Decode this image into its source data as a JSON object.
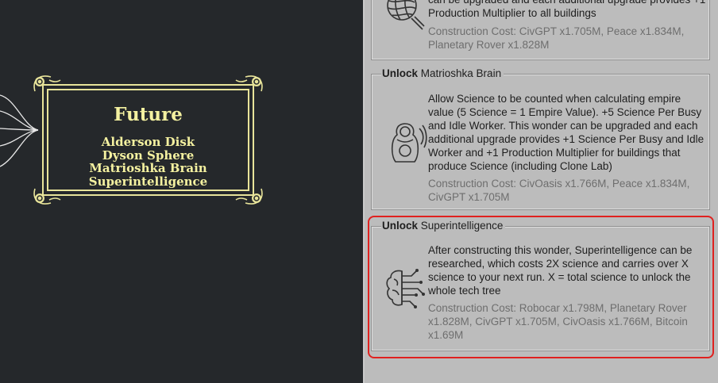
{
  "tech_tree": {
    "era": {
      "title": "Future",
      "wonders": [
        "Alderson Disk",
        "Dyson Sphere",
        "Matrioshka Brain",
        "Superintelligence"
      ]
    }
  },
  "wonders": [
    {
      "unlock_prefix": "",
      "name": "",
      "description": "can be upgraded and each additional upgrade provides +1 Production Multiplier to all buildings",
      "cost": "Construction Cost: CivGPT x1.705M, Peace x1.834M, Planetary Rover x1.828M",
      "icon": "yarn-ball-icon"
    },
    {
      "unlock_prefix": "Unlock",
      "name": "Matrioshka Brain",
      "description": "Allow Science to be counted when calculating empire value (5 Science = 1 Empire Value). +5 Science Per Busy and Idle Worker. This wonder can be upgraded and each additional upgrade provides +1 Science Per Busy and Idle Worker and +1 Production Multiplier for buildings that produce Science (including Clone Lab)",
      "cost": "Construction Cost: CivOasis x1.766M, Peace x1.834M, CivGPT x1.705M",
      "icon": "matryoshka-doll-icon"
    },
    {
      "unlock_prefix": "Unlock",
      "name": "Superintelligence",
      "description": "After constructing this wonder, Superintelligence can be researched, which costs 2X science and carries over X science to your next run. X = total science to unlock the whole tech tree",
      "cost": "Construction Cost: Robocar x1.798M, Planetary Rover x1.828M, CivGPT x1.705M, CivOasis x1.766M, Bitcoin x1.69M",
      "icon": "ai-brain-icon"
    }
  ],
  "colors": {
    "canvas_bg": "#25282b",
    "era_gold": "#f4f1a0",
    "panel_bg": "#bcbcbc",
    "highlight": "#e0211f"
  }
}
